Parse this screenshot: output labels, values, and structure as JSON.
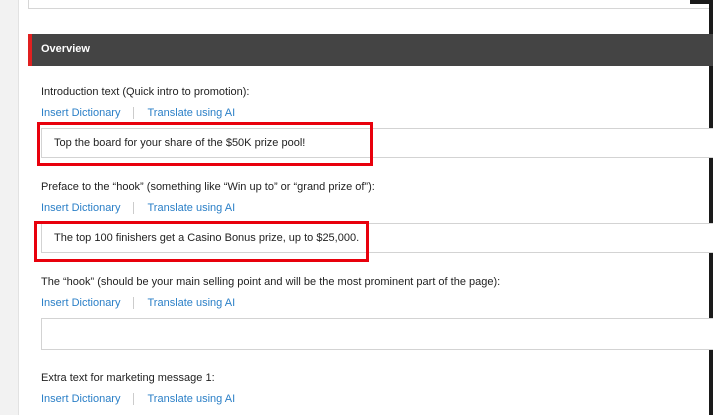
{
  "section": {
    "title": "Overview"
  },
  "fields": [
    {
      "label": "Introduction text (Quick intro to promotion):",
      "insert_dictionary": "Insert Dictionary",
      "translate_ai": "Translate using AI",
      "value": "Top the board for your share of the $50K prize pool!",
      "highlighted": true
    },
    {
      "label": "Preface to the “hook” (something like “Win up to” or “grand prize of”):",
      "insert_dictionary": "Insert Dictionary",
      "translate_ai": "Translate using AI",
      "value": "The top 100 finishers get a Casino Bonus prize, up to $25,000.",
      "highlighted": true
    },
    {
      "label": "The “hook” (should be your main selling point and will be the most prominent part of the page):",
      "insert_dictionary": "Insert Dictionary",
      "translate_ai": "Translate using AI",
      "value": "",
      "highlighted": false
    },
    {
      "label": "Extra text for marketing message 1:",
      "insert_dictionary": "Insert Dictionary",
      "translate_ai": "Translate using AI"
    }
  ],
  "colors": {
    "header_bg": "#444444",
    "header_accent": "#e02020",
    "link": "#2a7fc7",
    "highlight": "#e8000c"
  }
}
